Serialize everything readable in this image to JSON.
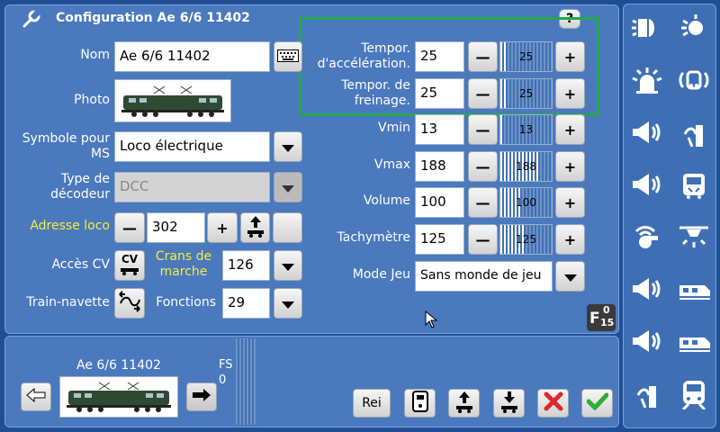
{
  "header": {
    "title": "Configuration Ae 6/6 11402",
    "help_label": "?"
  },
  "left": {
    "name_label": "Nom",
    "name_value": "Ae 6/6 11402",
    "photo_label": "Photo",
    "symbol_label": "Symbole pour MS",
    "symbol_value": "Loco électrique",
    "decoder_label": "Type de décodeur",
    "decoder_value": "DCC",
    "address_label": "Adresse loco",
    "address_value": "302",
    "cv_label": "Accès CV",
    "cv_button": "CV",
    "steps_label": "Crans de marche",
    "steps_value": "126",
    "shuttle_label": "Train-navette",
    "functions_label": "Fonctions",
    "functions_value": "29"
  },
  "right_params": [
    {
      "label": "Tempor. d'accélération.",
      "value": "25",
      "slider_value": "25",
      "fraction": 0.1
    },
    {
      "label": "Tempor. de freinage.",
      "value": "25",
      "slider_value": "25",
      "fraction": 0.1
    },
    {
      "label": "Vmin",
      "value": "13",
      "slider_value": "13",
      "fraction": 0.05
    },
    {
      "label": "Vmax",
      "value": "188",
      "slider_value": "188",
      "fraction": 0.74
    },
    {
      "label": "Volume",
      "value": "100",
      "slider_value": "100",
      "fraction": 0.39
    },
    {
      "label": "Tachymètre",
      "value": "125",
      "slider_value": "125",
      "fraction": 0.49
    }
  ],
  "mode": {
    "label": "Mode Jeu",
    "value": "Sans monde de jeu"
  },
  "f_badge": {
    "letter": "F",
    "top": "0",
    "bottom": "15"
  },
  "bottom": {
    "loco_name": "Ae 6/6 11402",
    "fs_label": "FS",
    "fs_value": "0",
    "rei_label": "Rei"
  },
  "colors": {
    "accent_yellow": "#f3ef3f",
    "highlight_green": "#24a94a",
    "panel_blue": "#4a79bd",
    "bg_blue": "#1f4f93"
  },
  "sidebar_icons": [
    "head-light-icon",
    "cab-light-icon",
    "beacon-icon",
    "radio-loco-icon",
    "horn-icon",
    "pantograph-horn-icon",
    "horn-long-icon",
    "interior-light-icon",
    "whistle-icon",
    "roof-light-icon",
    "horn-high-icon",
    "train-side-light-icon",
    "horn-low-icon",
    "train-front-light-icon",
    "pantograph-icon",
    "train-lights-icon"
  ]
}
